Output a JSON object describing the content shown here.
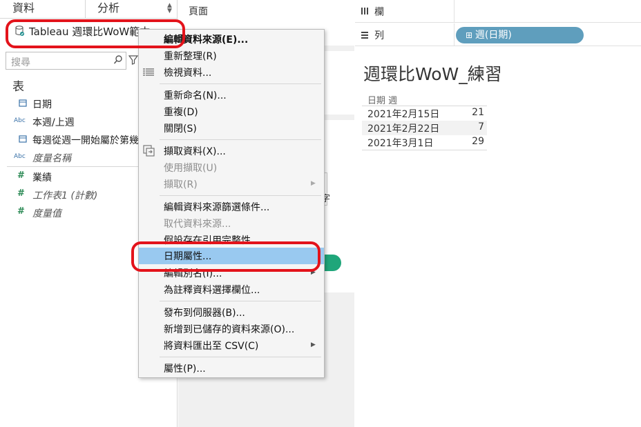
{
  "left_pane": {
    "tabs": {
      "data": "資料",
      "analytics": "分析"
    },
    "datasource_name": "Tableau 週環比WoW範本",
    "search_placeholder": "搜尋",
    "section_title": "表",
    "fields": [
      {
        "type_icon": "📅",
        "name": "日期"
      },
      {
        "type_icon": "Abc",
        "name": "本週/上週"
      },
      {
        "type_icon": "📅",
        "name": "每週從週一開始屬於第幾週"
      },
      {
        "type_icon": "Abc",
        "name": "度量名稱"
      },
      {
        "type_icon": "#",
        "name": "業績"
      },
      {
        "type_icon": "#",
        "name": "工作表1 (計數)"
      },
      {
        "type_icon": "#",
        "name": "度量值"
      }
    ]
  },
  "middle_pane": {
    "pages_title": "頁面",
    "partial_text": "字"
  },
  "view": {
    "columns_label": "欄",
    "rows_label": "列",
    "rows_pill": "週(日期)",
    "title": "週環比WoW_練習",
    "column_header": "日期 週",
    "rows": [
      {
        "date": "2021年2月15日",
        "value": "21"
      },
      {
        "date": "2021年2月22日",
        "value": "7"
      },
      {
        "date": "2021年3月1日",
        "value": "29"
      }
    ]
  },
  "context_menu": {
    "items": [
      {
        "label": "編輯資料來源(E)...",
        "bold": true
      },
      {
        "label": "重新整理(R)"
      },
      {
        "label": "檢視資料..."
      },
      {
        "label": "重新命名(N)..."
      },
      {
        "label": "重複(D)"
      },
      {
        "label": "關閉(S)"
      },
      {
        "label": "擷取資料(X)..."
      },
      {
        "label": "使用擷取(U)",
        "disabled": true
      },
      {
        "label": "擷取(R)",
        "disabled": true,
        "submenu": true
      },
      {
        "label": "編輯資料來源篩選條件..."
      },
      {
        "label": "取代資料來源...",
        "disabled": true
      },
      {
        "label": "假設存在引用完整性"
      },
      {
        "label": "日期屬性...",
        "highlighted": true
      },
      {
        "label": "編輯別名(I)...",
        "submenu": true
      },
      {
        "label": "為註釋資料選擇欄位..."
      },
      {
        "label": "發布到伺服器(B)..."
      },
      {
        "label": "新增到已儲存的資料來源(O)..."
      },
      {
        "label": "將資料匯出至 CSV(C)",
        "submenu": true
      },
      {
        "label": "屬性(P)..."
      }
    ]
  },
  "colors": {
    "highlight": "#99c9f0",
    "annotation_red": "#e3131b",
    "pill_blue": "#5f9ebd",
    "measure_green": "#2e8b57"
  }
}
